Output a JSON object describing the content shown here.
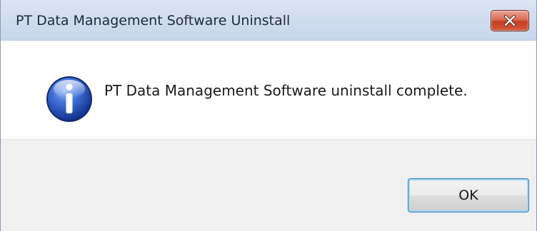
{
  "window": {
    "title": "PT Data Management Software Uninstall"
  },
  "message": {
    "text": "PT Data Management Software uninstall complete.",
    "icon": "information-icon"
  },
  "buttons": {
    "ok_label": "OK",
    "close_icon": "close-icon"
  },
  "colors": {
    "titlebar": "#d1ddef",
    "close_button": "#c43d22",
    "footer": "#f0f0f0",
    "ok_focus_border": "#3c7fb1"
  }
}
